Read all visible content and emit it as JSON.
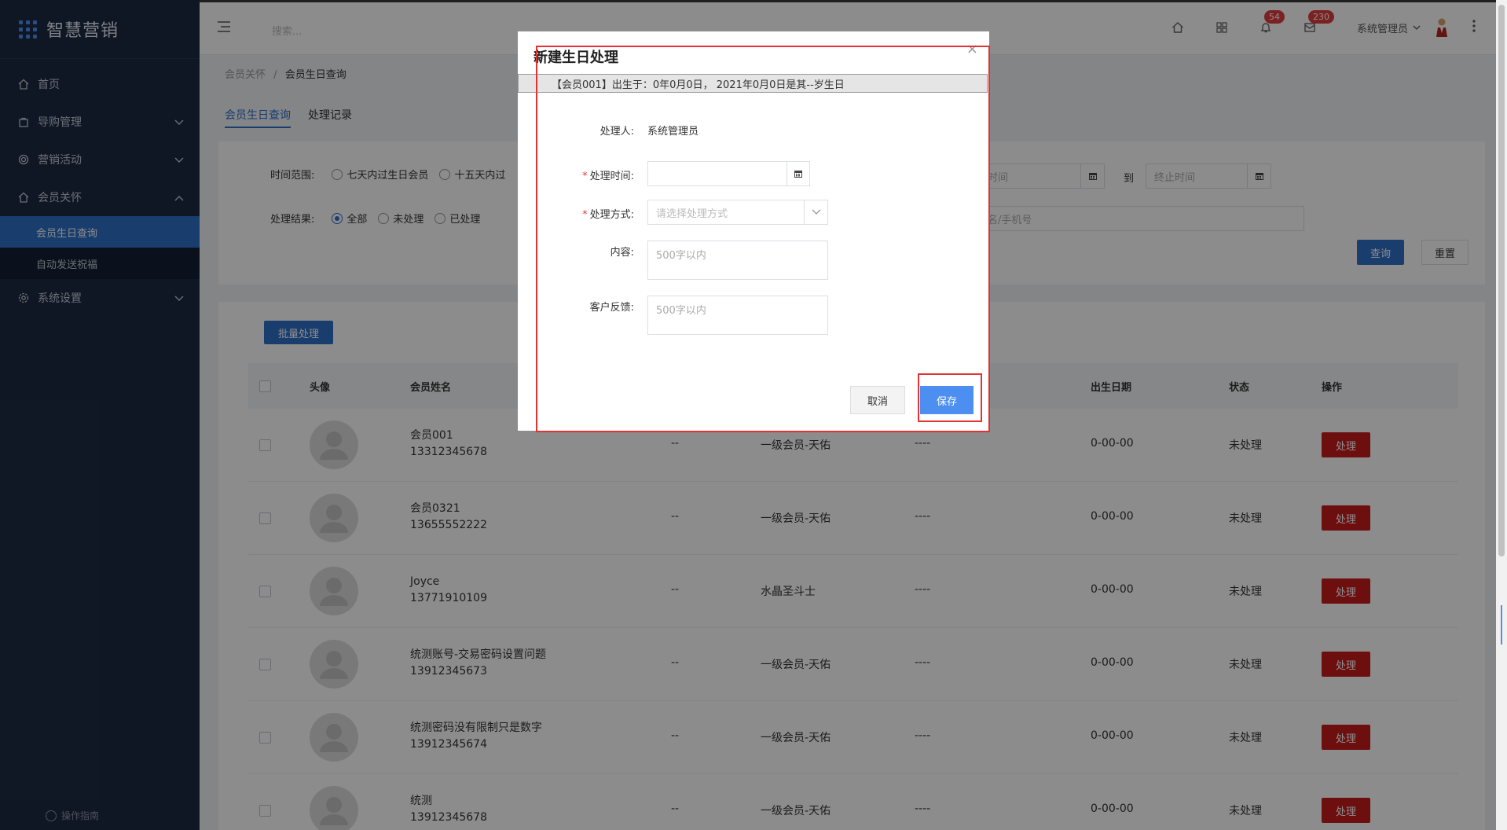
{
  "app": {
    "logo_text": "智慧营销"
  },
  "sidebar": {
    "items": [
      {
        "label": "首页",
        "icon": "home-icon"
      },
      {
        "label": "导购管理",
        "icon": "bag-icon"
      },
      {
        "label": "营销活动",
        "icon": "target-icon"
      },
      {
        "label": "会员关怀",
        "icon": "home-icon"
      },
      {
        "label": "系统设置",
        "icon": "gear-icon"
      }
    ],
    "sub_items": [
      {
        "label": "会员生日查询"
      },
      {
        "label": "自动发送祝福"
      }
    ],
    "footer": "操作指南"
  },
  "topbar": {
    "search_placeholder": "搜索...",
    "notify_badge": "54",
    "message_badge": "230",
    "user_name": "系统管理员"
  },
  "breadcrumb": {
    "parent": "会员关怀",
    "sep": "/",
    "current": "会员生日查询"
  },
  "tabs": [
    {
      "label": "会员生日查询"
    },
    {
      "label": "处理记录"
    }
  ],
  "filter": {
    "time_label": "时间范围:",
    "time_options": [
      "七天内过生日会员",
      "十五天内过"
    ],
    "start_placeholder": "时间",
    "to": "到",
    "end_placeholder": "终止时间",
    "result_label": "处理结果:",
    "result_options": [
      "全部",
      "未处理",
      "已处理"
    ],
    "keyword_placeholder": "名/手机号",
    "query_label": "查询",
    "reset_label": "重置"
  },
  "list": {
    "batch_label": "批量处理",
    "headers": {
      "avatar": "头像",
      "name": "会员姓名",
      "birth": "出生日期",
      "status": "状态",
      "action": "操作"
    },
    "rows": [
      {
        "name": "会员001",
        "phone": "13312345678",
        "col3": "--",
        "level": "一级会员-天佑",
        "col5": "----",
        "birth": "0-00-00",
        "status": "未处理",
        "action": "处理"
      },
      {
        "name": "会员0321",
        "phone": "13655552222",
        "col3": "--",
        "level": "一级会员-天佑",
        "col5": "----",
        "birth": "0-00-00",
        "status": "未处理",
        "action": "处理"
      },
      {
        "name": "Joyce",
        "phone": "13771910109",
        "col3": "--",
        "level": "水晶圣斗士",
        "col5": "----",
        "birth": "0-00-00",
        "status": "未处理",
        "action": "处理"
      },
      {
        "name": "统测账号-交易密码设置问题",
        "phone": "13912345673",
        "col3": "--",
        "level": "一级会员-天佑",
        "col5": "----",
        "birth": "0-00-00",
        "status": "未处理",
        "action": "处理"
      },
      {
        "name": "统测密码没有限制只是数字",
        "phone": "13912345674",
        "col3": "--",
        "level": "一级会员-天佑",
        "col5": "----",
        "birth": "0-00-00",
        "status": "未处理",
        "action": "处理"
      },
      {
        "name": "统测",
        "phone": "13912345678",
        "col3": "--",
        "level": "一级会员-天佑",
        "col5": "----",
        "birth": "0-00-00",
        "status": "未处理",
        "action": "处理"
      }
    ]
  },
  "modal": {
    "title": "新建生日处理",
    "close": "×",
    "banner": "【会员001】出生于：0年0月0日， 2021年0月0日是其--岁生日",
    "handler_label": "处理人:",
    "handler_value": "系统管理员",
    "req_mark": "*",
    "time_label": "处理时间:",
    "method_label": "处理方式:",
    "method_placeholder": "请选择处理方式",
    "content_label": "内容:",
    "content_placeholder": "500字以内",
    "feedback_label": "客户反馈:",
    "feedback_placeholder": "500字以内",
    "cancel_label": "取消",
    "save_label": "保存"
  },
  "colors": {
    "sidebar_bg": "#1d2b44",
    "primary": "#2f6fc7",
    "danger": "#c81d1d",
    "highlight": "#e03333"
  }
}
